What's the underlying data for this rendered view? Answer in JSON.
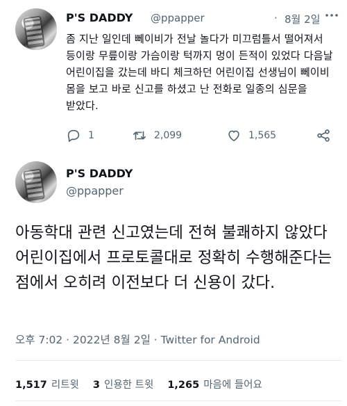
{
  "tweet1": {
    "name": "P'S DADDY",
    "handle": "@ppapper",
    "separator": "·",
    "date": "8월 2일",
    "text": "좀 지난 일인데 뻬이비가 전날 놀다가 미끄럼틀서 떨어져서 등이랑 무릎이랑 가슴이랑 턱까지 멍이 든적이 있었다 다음날 어린이집을 갔는데 바디 체크하던 어린이집 선생님이 뻬이비 몸을 보고 바로 신고를 하셨고 난 전화로 일종의 심문을 받았다.",
    "replies": "1",
    "retweets": "2,099",
    "likes": "1,565",
    "icons": {
      "reply": "reply-icon",
      "retweet": "retweet-icon",
      "like": "heart-icon",
      "share": "share-icon",
      "more": "more-icon"
    }
  },
  "tweet2": {
    "name": "P'S DADDY",
    "handle": "@ppapper",
    "text": "아동학대 관련 신고였는데 전혀 불쾌하지 않았다 어린이집에서 프로토콜대로 정확히 수행해준다는 점에서 오히려 이전보다 더 신용이 갔다.",
    "meta": "오후 7:02 · 2022년 8월 2일 · Twitter for Android",
    "stats": [
      {
        "count": "1,517",
        "label": "리트윗"
      },
      {
        "count": "3",
        "label": "인용한 트윗"
      },
      {
        "count": "1,265",
        "label": "마음에 들어요"
      }
    ]
  },
  "colors": {
    "text": "#0f1419",
    "secondary": "#536471",
    "divider": "#e6ecf0"
  }
}
